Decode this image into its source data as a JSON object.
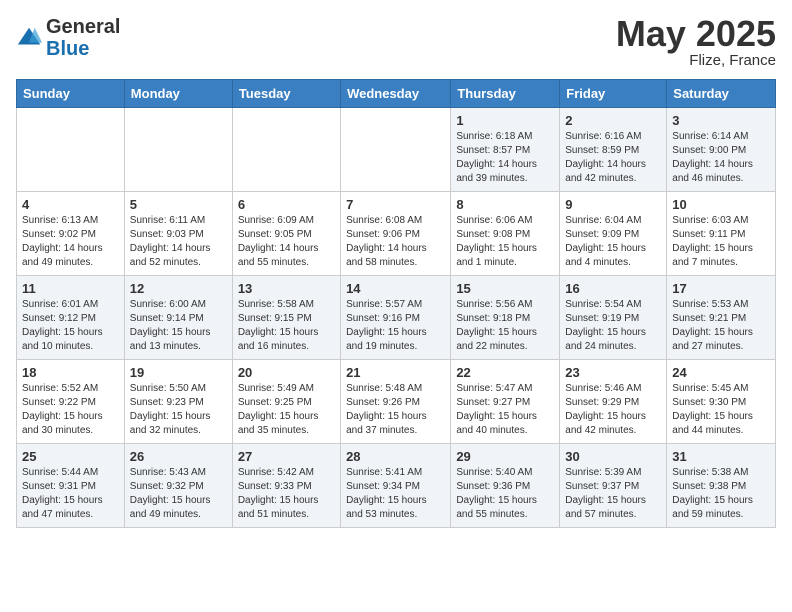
{
  "header": {
    "logo_line1": "General",
    "logo_line2": "Blue",
    "month_year": "May 2025",
    "location": "Flize, France"
  },
  "days_of_week": [
    "Sunday",
    "Monday",
    "Tuesday",
    "Wednesday",
    "Thursday",
    "Friday",
    "Saturday"
  ],
  "weeks": [
    [
      {
        "day": "",
        "detail": ""
      },
      {
        "day": "",
        "detail": ""
      },
      {
        "day": "",
        "detail": ""
      },
      {
        "day": "",
        "detail": ""
      },
      {
        "day": "1",
        "detail": "Sunrise: 6:18 AM\nSunset: 8:57 PM\nDaylight: 14 hours\nand 39 minutes."
      },
      {
        "day": "2",
        "detail": "Sunrise: 6:16 AM\nSunset: 8:59 PM\nDaylight: 14 hours\nand 42 minutes."
      },
      {
        "day": "3",
        "detail": "Sunrise: 6:14 AM\nSunset: 9:00 PM\nDaylight: 14 hours\nand 46 minutes."
      }
    ],
    [
      {
        "day": "4",
        "detail": "Sunrise: 6:13 AM\nSunset: 9:02 PM\nDaylight: 14 hours\nand 49 minutes."
      },
      {
        "day": "5",
        "detail": "Sunrise: 6:11 AM\nSunset: 9:03 PM\nDaylight: 14 hours\nand 52 minutes."
      },
      {
        "day": "6",
        "detail": "Sunrise: 6:09 AM\nSunset: 9:05 PM\nDaylight: 14 hours\nand 55 minutes."
      },
      {
        "day": "7",
        "detail": "Sunrise: 6:08 AM\nSunset: 9:06 PM\nDaylight: 14 hours\nand 58 minutes."
      },
      {
        "day": "8",
        "detail": "Sunrise: 6:06 AM\nSunset: 9:08 PM\nDaylight: 15 hours\nand 1 minute."
      },
      {
        "day": "9",
        "detail": "Sunrise: 6:04 AM\nSunset: 9:09 PM\nDaylight: 15 hours\nand 4 minutes."
      },
      {
        "day": "10",
        "detail": "Sunrise: 6:03 AM\nSunset: 9:11 PM\nDaylight: 15 hours\nand 7 minutes."
      }
    ],
    [
      {
        "day": "11",
        "detail": "Sunrise: 6:01 AM\nSunset: 9:12 PM\nDaylight: 15 hours\nand 10 minutes."
      },
      {
        "day": "12",
        "detail": "Sunrise: 6:00 AM\nSunset: 9:14 PM\nDaylight: 15 hours\nand 13 minutes."
      },
      {
        "day": "13",
        "detail": "Sunrise: 5:58 AM\nSunset: 9:15 PM\nDaylight: 15 hours\nand 16 minutes."
      },
      {
        "day": "14",
        "detail": "Sunrise: 5:57 AM\nSunset: 9:16 PM\nDaylight: 15 hours\nand 19 minutes."
      },
      {
        "day": "15",
        "detail": "Sunrise: 5:56 AM\nSunset: 9:18 PM\nDaylight: 15 hours\nand 22 minutes."
      },
      {
        "day": "16",
        "detail": "Sunrise: 5:54 AM\nSunset: 9:19 PM\nDaylight: 15 hours\nand 24 minutes."
      },
      {
        "day": "17",
        "detail": "Sunrise: 5:53 AM\nSunset: 9:21 PM\nDaylight: 15 hours\nand 27 minutes."
      }
    ],
    [
      {
        "day": "18",
        "detail": "Sunrise: 5:52 AM\nSunset: 9:22 PM\nDaylight: 15 hours\nand 30 minutes."
      },
      {
        "day": "19",
        "detail": "Sunrise: 5:50 AM\nSunset: 9:23 PM\nDaylight: 15 hours\nand 32 minutes."
      },
      {
        "day": "20",
        "detail": "Sunrise: 5:49 AM\nSunset: 9:25 PM\nDaylight: 15 hours\nand 35 minutes."
      },
      {
        "day": "21",
        "detail": "Sunrise: 5:48 AM\nSunset: 9:26 PM\nDaylight: 15 hours\nand 37 minutes."
      },
      {
        "day": "22",
        "detail": "Sunrise: 5:47 AM\nSunset: 9:27 PM\nDaylight: 15 hours\nand 40 minutes."
      },
      {
        "day": "23",
        "detail": "Sunrise: 5:46 AM\nSunset: 9:29 PM\nDaylight: 15 hours\nand 42 minutes."
      },
      {
        "day": "24",
        "detail": "Sunrise: 5:45 AM\nSunset: 9:30 PM\nDaylight: 15 hours\nand 44 minutes."
      }
    ],
    [
      {
        "day": "25",
        "detail": "Sunrise: 5:44 AM\nSunset: 9:31 PM\nDaylight: 15 hours\nand 47 minutes."
      },
      {
        "day": "26",
        "detail": "Sunrise: 5:43 AM\nSunset: 9:32 PM\nDaylight: 15 hours\nand 49 minutes."
      },
      {
        "day": "27",
        "detail": "Sunrise: 5:42 AM\nSunset: 9:33 PM\nDaylight: 15 hours\nand 51 minutes."
      },
      {
        "day": "28",
        "detail": "Sunrise: 5:41 AM\nSunset: 9:34 PM\nDaylight: 15 hours\nand 53 minutes."
      },
      {
        "day": "29",
        "detail": "Sunrise: 5:40 AM\nSunset: 9:36 PM\nDaylight: 15 hours\nand 55 minutes."
      },
      {
        "day": "30",
        "detail": "Sunrise: 5:39 AM\nSunset: 9:37 PM\nDaylight: 15 hours\nand 57 minutes."
      },
      {
        "day": "31",
        "detail": "Sunrise: 5:38 AM\nSunset: 9:38 PM\nDaylight: 15 hours\nand 59 minutes."
      }
    ]
  ]
}
